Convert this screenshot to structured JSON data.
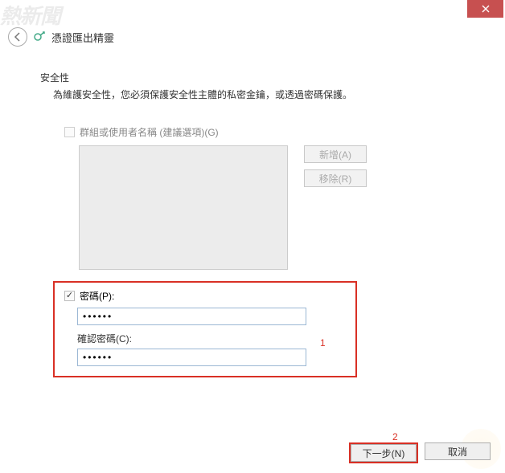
{
  "titlebar": {
    "close_icon": "close"
  },
  "wizard": {
    "title": "憑證匯出精靈"
  },
  "security": {
    "heading": "安全性",
    "description": "為維護安全性，您必須保護安全性主體的私密金鑰，或透過密碼保護。"
  },
  "group": {
    "label": "群組或使用者名稱 (建議選項)(G)",
    "add_btn": "新增(A)",
    "remove_btn": "移除(R)"
  },
  "password": {
    "label": "密碼(P):",
    "value": "••••••",
    "confirm_label": "確認密碼(C):",
    "confirm_value": "••••••"
  },
  "annotations": {
    "box1": "1",
    "box2": "2"
  },
  "footer": {
    "next": "下一步(N)",
    "cancel": "取消"
  },
  "watermark": "熱新聞"
}
